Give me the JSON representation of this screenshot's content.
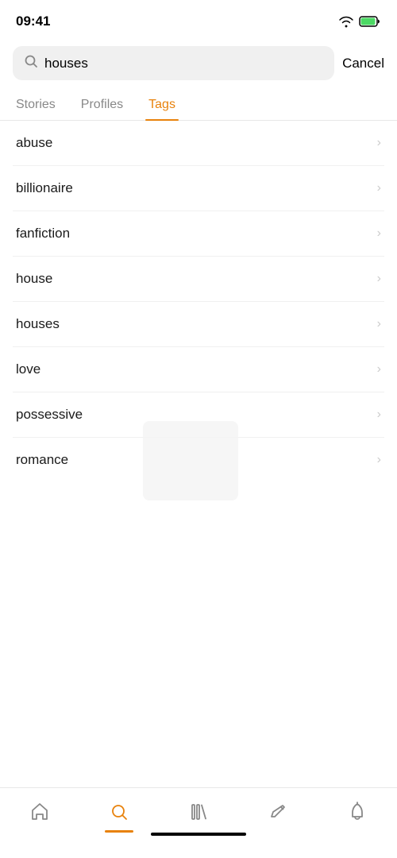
{
  "statusBar": {
    "time": "09:41"
  },
  "searchBar": {
    "value": "houses",
    "placeholder": "Search",
    "cancelLabel": "Cancel"
  },
  "tabs": [
    {
      "id": "stories",
      "label": "Stories",
      "active": false
    },
    {
      "id": "profiles",
      "label": "Profiles",
      "active": false
    },
    {
      "id": "tags",
      "label": "Tags",
      "active": true
    }
  ],
  "tagItems": [
    {
      "id": "abuse",
      "label": "abuse"
    },
    {
      "id": "billionaire",
      "label": "billionaire"
    },
    {
      "id": "fanfiction",
      "label": "fanfiction"
    },
    {
      "id": "house",
      "label": "house"
    },
    {
      "id": "houses",
      "label": "houses"
    },
    {
      "id": "love",
      "label": "love"
    },
    {
      "id": "possessive",
      "label": "possessive"
    },
    {
      "id": "romance",
      "label": "romance"
    }
  ],
  "bottomNav": [
    {
      "id": "home",
      "label": "Home",
      "active": false
    },
    {
      "id": "search",
      "label": "Search",
      "active": true
    },
    {
      "id": "library",
      "label": "Library",
      "active": false
    },
    {
      "id": "write",
      "label": "Write",
      "active": false
    },
    {
      "id": "notifications",
      "label": "Notifications",
      "active": false
    }
  ],
  "colors": {
    "accent": "#e8820c",
    "inactive": "#888",
    "border": "#f0f0f0"
  }
}
